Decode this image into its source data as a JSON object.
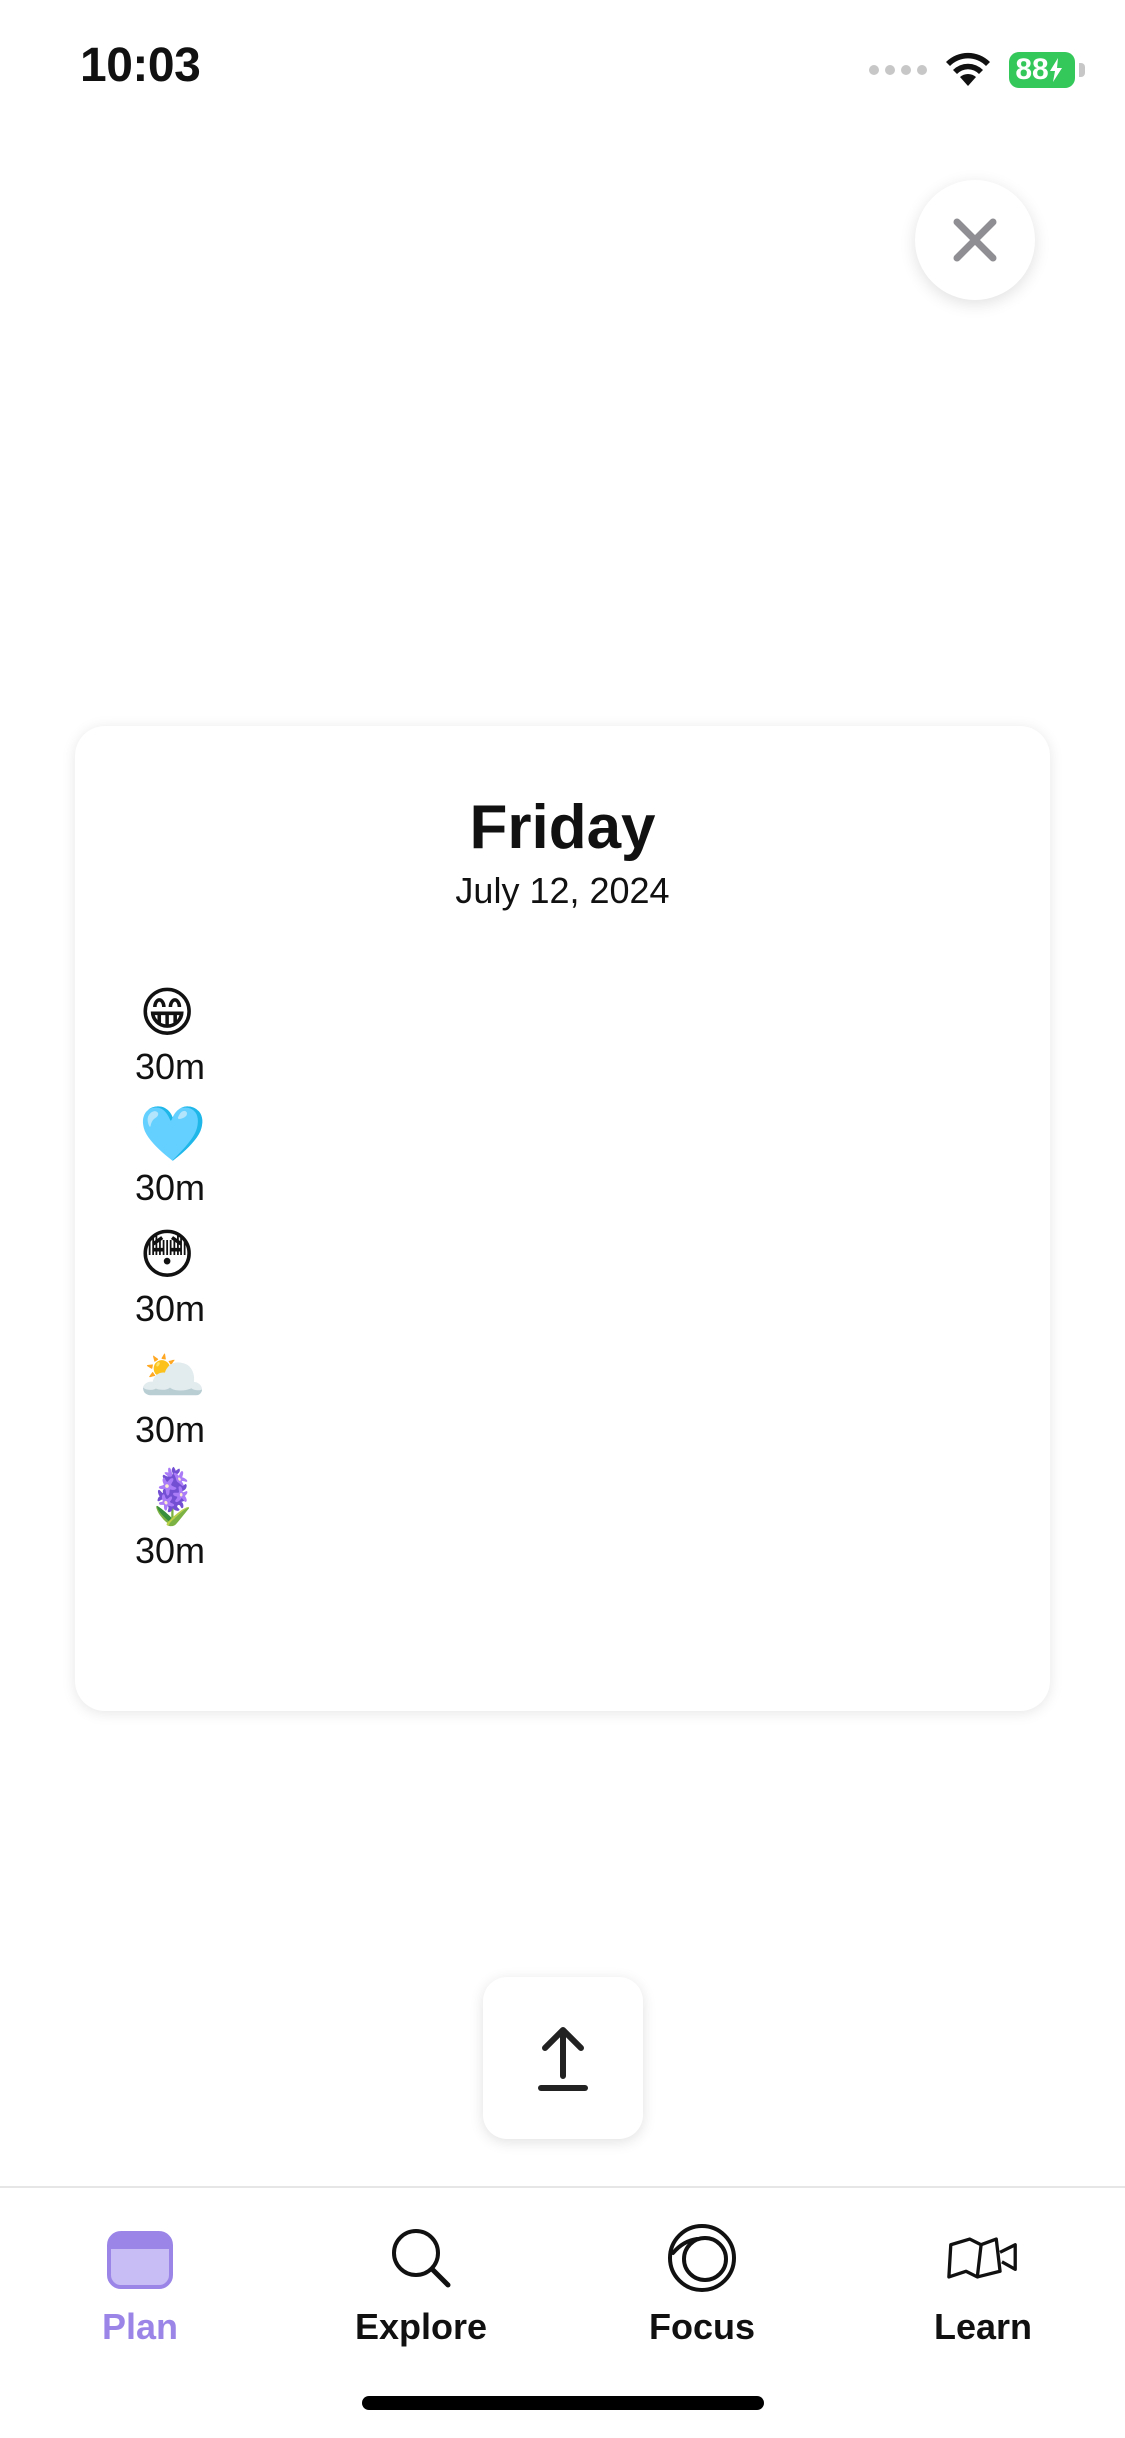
{
  "status_bar": {
    "time": "10:03",
    "battery": "88"
  },
  "close_button": {
    "icon": "close-icon"
  },
  "card": {
    "day": "Friday",
    "date": "July 12, 2024",
    "entries": [
      {
        "emoji": "😁",
        "duration": "30m"
      },
      {
        "emoji": "🩵",
        "duration": "30m"
      },
      {
        "emoji": "😳",
        "duration": "30m"
      },
      {
        "emoji": "🌥️",
        "duration": "30m"
      },
      {
        "emoji": "🪻",
        "duration": "30m"
      }
    ]
  },
  "share_button": {
    "icon": "upload-icon"
  },
  "tabs": [
    {
      "label": "Plan",
      "icon": "calendar-icon",
      "active": true
    },
    {
      "label": "Explore",
      "icon": "search-icon",
      "active": false
    },
    {
      "label": "Focus",
      "icon": "focus-icon",
      "active": false
    },
    {
      "label": "Learn",
      "icon": "book-icon",
      "active": false
    }
  ],
  "colors": {
    "accent": "#9b86e8",
    "battery": "#34c759",
    "text": "#111111"
  }
}
